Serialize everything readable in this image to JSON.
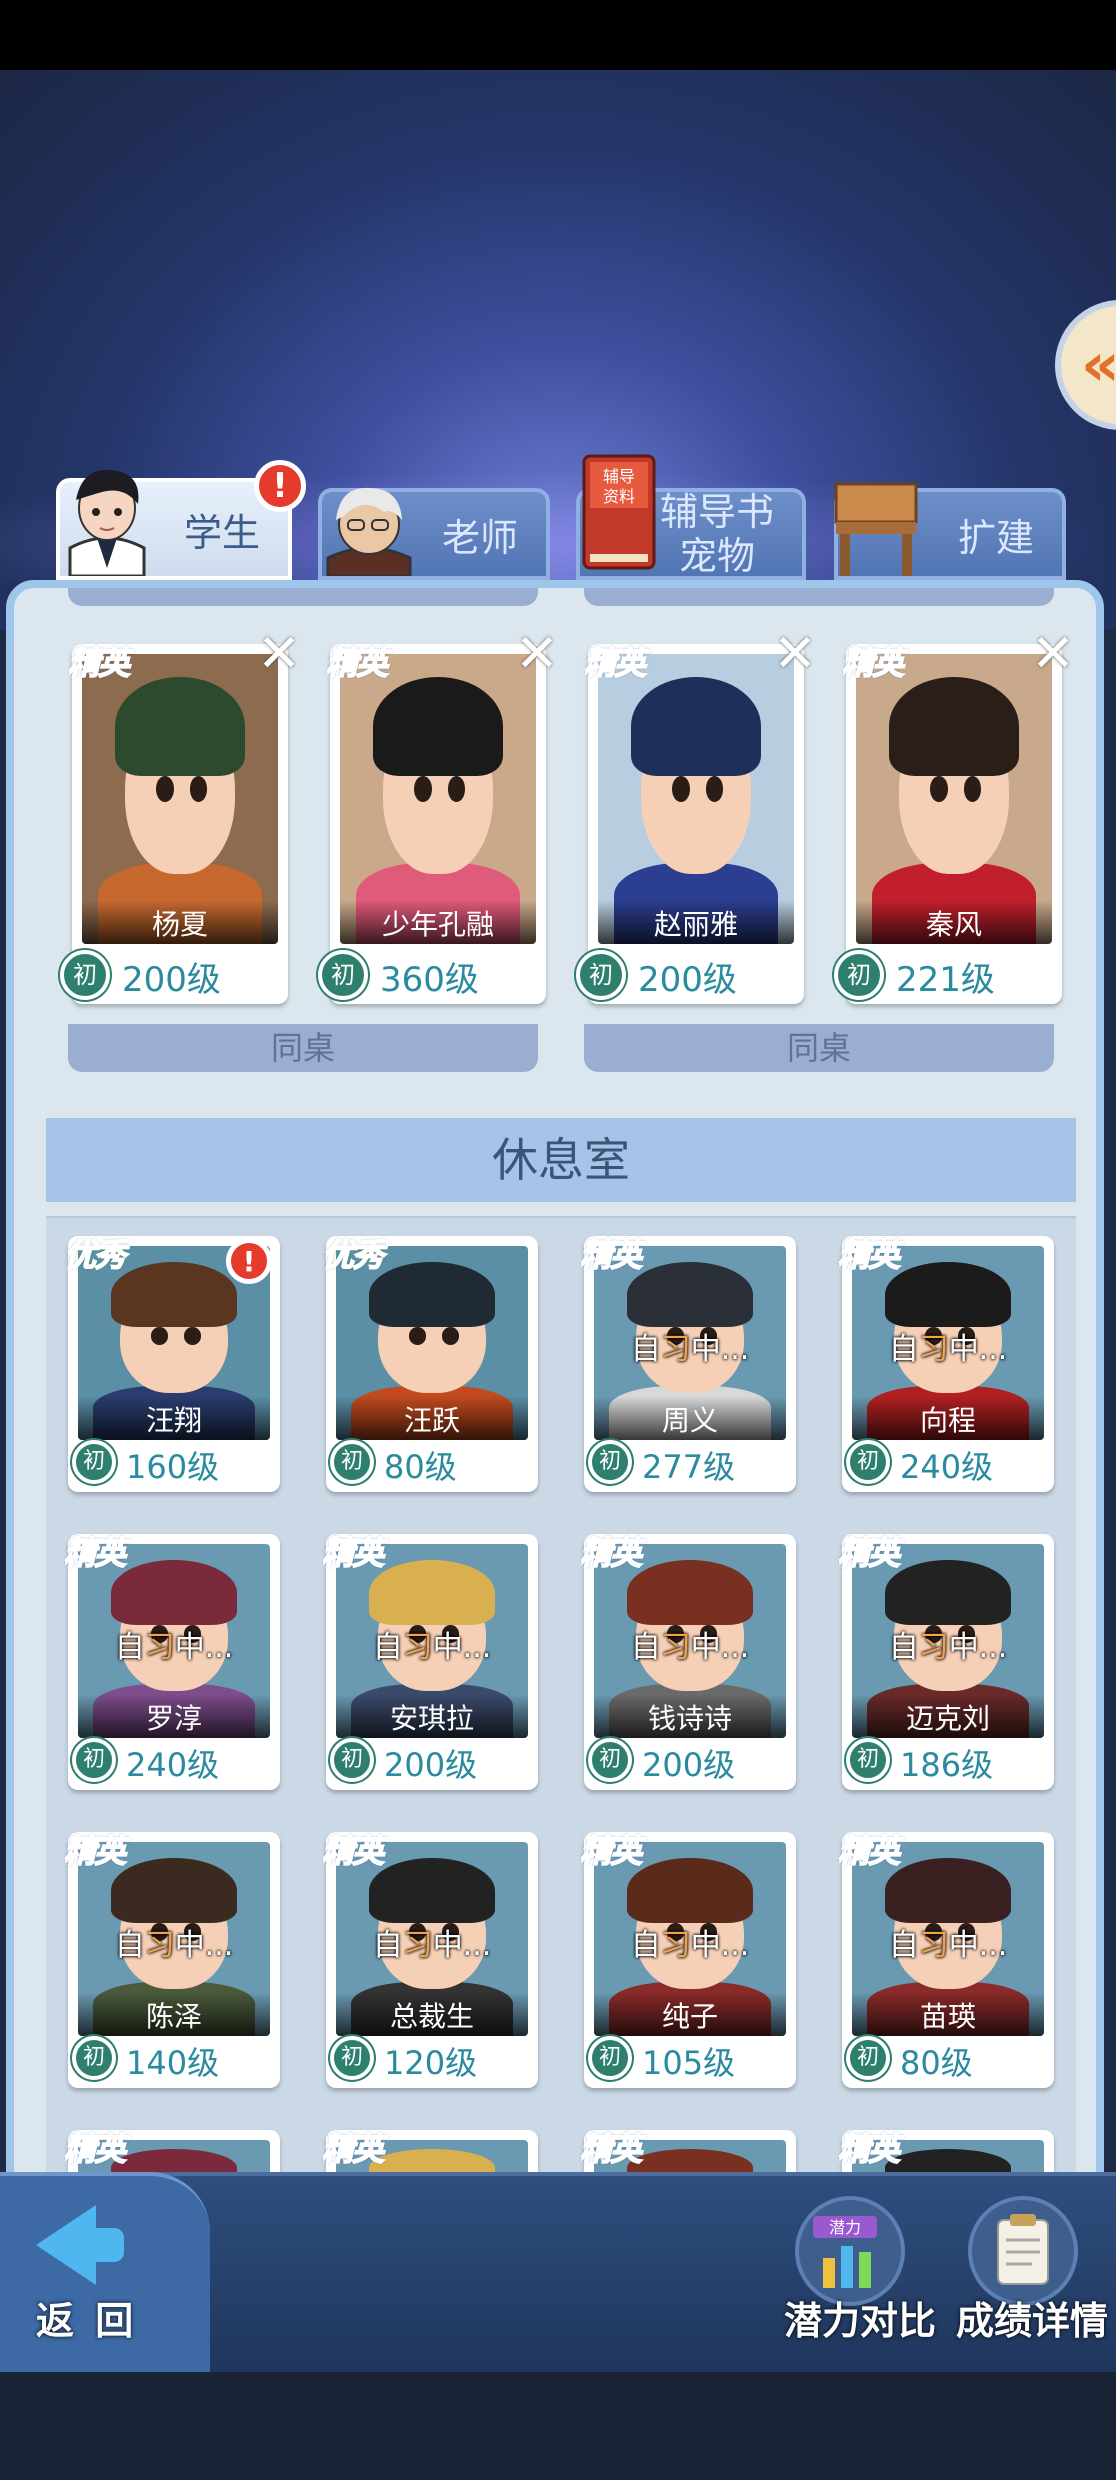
{
  "tabs": [
    {
      "label": "学生",
      "active": true,
      "badge": "!"
    },
    {
      "label": "老师",
      "active": false
    },
    {
      "label_line1": "辅导书",
      "label_line2": "宠物",
      "icon_text": "辅导资料",
      "active": false
    },
    {
      "label": "扩建",
      "active": false
    }
  ],
  "desk_label": "同桌",
  "desk_cards": [
    {
      "tag": "精英",
      "name": "杨夏",
      "rank": "初",
      "level": "200级"
    },
    {
      "tag": "精英",
      "name": "少年孔融",
      "rank": "初",
      "level": "360级"
    },
    {
      "tag": "精英",
      "name": "赵丽雅",
      "rank": "初",
      "level": "200级"
    },
    {
      "tag": "精英",
      "name": "秦风",
      "rank": "初",
      "level": "221级"
    }
  ],
  "lounge": {
    "title": "休息室",
    "studying_prefix": "自",
    "studying_highlight": "习",
    "studying_suffix": "中...",
    "cards": [
      {
        "tag": "优秀",
        "tag_type": "excellent",
        "name": "汪翔",
        "rank": "初",
        "level": "160级",
        "badge": "!"
      },
      {
        "tag": "优秀",
        "tag_type": "excellent",
        "name": "汪跃",
        "rank": "初",
        "level": "80级"
      },
      {
        "tag": "精英",
        "tag_type": "elite",
        "name": "周义",
        "rank": "初",
        "level": "277级",
        "studying": true
      },
      {
        "tag": "精英",
        "tag_type": "elite",
        "name": "向程",
        "rank": "初",
        "level": "240级",
        "studying": true
      },
      {
        "tag": "精英",
        "tag_type": "elite",
        "name": "罗淳",
        "rank": "初",
        "level": "240级",
        "studying": true
      },
      {
        "tag": "精英",
        "tag_type": "elite",
        "name": "安琪拉",
        "rank": "初",
        "level": "200级",
        "studying": true
      },
      {
        "tag": "精英",
        "tag_type": "elite",
        "name": "钱诗诗",
        "rank": "初",
        "level": "200级",
        "studying": true
      },
      {
        "tag": "精英",
        "tag_type": "elite",
        "name": "迈克刘",
        "rank": "初",
        "level": "186级",
        "studying": true
      },
      {
        "tag": "精英",
        "tag_type": "elite",
        "name": "陈泽",
        "rank": "初",
        "level": "140级",
        "studying": true
      },
      {
        "tag": "精英",
        "tag_type": "elite",
        "name": "总裁生",
        "rank": "初",
        "level": "120级",
        "studying": true
      },
      {
        "tag": "精英",
        "tag_type": "elite",
        "name": "纯子",
        "rank": "初",
        "level": "105级",
        "studying": true
      },
      {
        "tag": "精英",
        "tag_type": "elite",
        "name": "苗瑛",
        "rank": "初",
        "level": "80级",
        "studying": true
      }
    ],
    "partial_row_tags": [
      "精英",
      "精英",
      "精英",
      "精英"
    ]
  },
  "bottom": {
    "back_label": "返 回",
    "potential_label": "潜力对比",
    "potential_icon_text": "潜力",
    "scores_label": "成绩详情"
  },
  "colors": {
    "panel": "#dbe6ee",
    "accent_level": "#2a8a9e",
    "elite_tag": "#6d99e8",
    "excellent_tag": "#8ad24a",
    "badge": "#e43b2c"
  }
}
